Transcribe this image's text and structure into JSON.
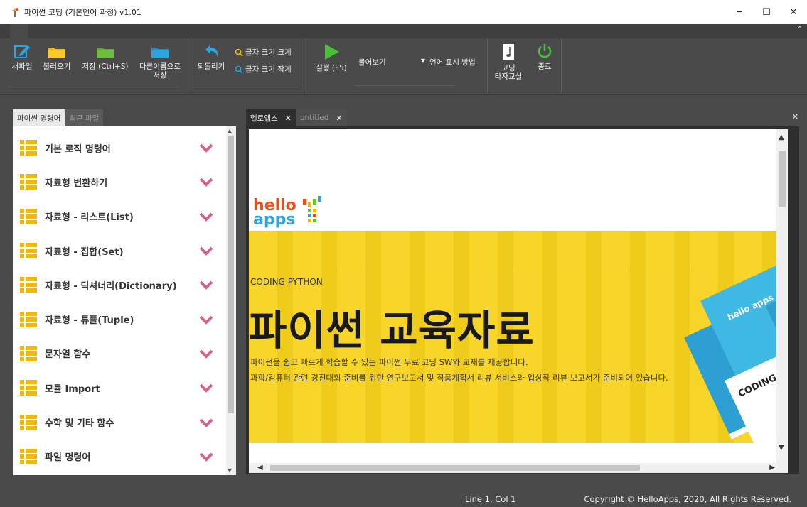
{
  "window": {
    "title": "파이썬 코딩 (기본언어 과정) v1.01",
    "controls": {
      "minimize": "─",
      "maximize": "☐",
      "close": "✕"
    }
  },
  "ribbon": {
    "collapse_glyph": "⌃",
    "buttons": {
      "new_file": "새파일",
      "open": "불러오기",
      "save": "저장 (Ctrl+S)",
      "save_as_line1": "다른이름으로",
      "save_as_line2": "저장",
      "undo": "되돌리기",
      "font_larger": "글자 크기 크게",
      "font_smaller": "글자 크기 작게",
      "run": "실행 (F5)",
      "lang_display": "언어 표시 방법",
      "typing_line1": "코딩",
      "typing_line2": "타자교실",
      "quit": "종료"
    },
    "select": {
      "value": "물어보기"
    }
  },
  "left_panel": {
    "tabs": [
      "파이썬 명령어",
      "최근 파일"
    ],
    "commands": [
      "기본 로직 명령어",
      "자료형 변환하기",
      "자료형 - 리스트(List)",
      "자료형 - 집합(Set)",
      "자료형 - 딕셔너리(Dictionary)",
      "자료형 - 튜플(Tuple)",
      "문자열 함수",
      "모듈 Import",
      "수학 및 기타 함수",
      "파일 명령어"
    ]
  },
  "editor": {
    "tabs": [
      "헬로앱스",
      "untitled"
    ],
    "tab_close": "✕",
    "close_all": "✕"
  },
  "web": {
    "logo_top": "hello",
    "logo_bottom": "apps",
    "subtitle": "CODING PYTHON",
    "headline": "파이썬 교육자료",
    "desc1": "파이썬을 쉽고 빠르게 학습할 수 있는 파이썬 무료 코딩 SW와 교재를 제공합니다.",
    "desc2": "과학/컴퓨터 관련 경진대회 준비를 위한 연구보고서 및 작품계획서 리뷰 서비스와 입상작 리뷰 보고서가 준비되어 있습니다.",
    "book_brand": "hello apps",
    "book_cover_text": "CODING EDUCATION BOOK"
  },
  "status": {
    "position": "Line 1, Col 1",
    "copyright": "Copyright © HelloApps, 2020, All Rights Reserved."
  },
  "colors": {
    "accent_blue": "#2aa5e0",
    "folder_yellow": "#f5b800",
    "folder_green": "#6cbf3c",
    "run_green": "#4bbf3a",
    "chevron_pink": "#d9608e",
    "banner_yellow": "#f7d21c",
    "book_blue": "#3fb8e3"
  }
}
